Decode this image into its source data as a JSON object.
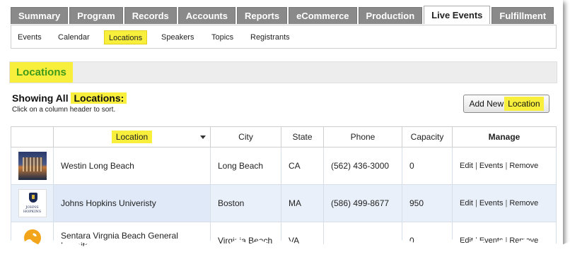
{
  "tabs": [
    {
      "label": "Summary",
      "active": false
    },
    {
      "label": "Program",
      "active": false
    },
    {
      "label": "Records",
      "active": false
    },
    {
      "label": "Accounts",
      "active": false
    },
    {
      "label": "Reports",
      "active": false
    },
    {
      "label": "eCommerce",
      "active": false
    },
    {
      "label": "Production",
      "active": false
    },
    {
      "label": "Live Events",
      "active": true
    },
    {
      "label": "Fulfillment",
      "active": false
    }
  ],
  "subnav": {
    "items": [
      {
        "label": "Events",
        "active": false
      },
      {
        "label": "Calendar",
        "active": false
      },
      {
        "label": "Locations",
        "active": true
      },
      {
        "label": "Speakers",
        "active": false
      },
      {
        "label": "Topics",
        "active": false
      },
      {
        "label": "Registrants",
        "active": false
      }
    ]
  },
  "page": {
    "title": "Locations",
    "showing_prefix": "Showing All",
    "showing_highlight": "Locations:",
    "sort_hint": "Click on a column header to sort.",
    "add_button_prefix": "Add New",
    "add_button_highlight": "Location"
  },
  "table": {
    "headers": {
      "location": "Location",
      "city": "City",
      "state": "State",
      "phone": "Phone",
      "capacity": "Capacity",
      "manage": "Manage"
    },
    "actions": {
      "edit": "Edit",
      "events": "Events",
      "remove": "Remove",
      "separator": "|"
    },
    "rows": [
      {
        "thumb": "hotel-photo",
        "name": "Westin Long Beach",
        "city": "Long Beach",
        "state": "CA",
        "phone": "(562) 436-3000",
        "capacity": "0"
      },
      {
        "thumb": "johns-hopkins-logo",
        "thumb_text": "JOHNS HOPKINS",
        "name": "Johns Hopkins Univeristy",
        "city": "Boston",
        "state": "MA",
        "phone": "(586) 499-8677",
        "capacity": "950"
      },
      {
        "thumb": "sentara-logo",
        "name": "Sentara Virgnia Beach General Hospital",
        "city": "Virginia Beach",
        "state": "VA",
        "phone": "",
        "capacity": "0"
      }
    ]
  },
  "colors": {
    "highlight": "#f7ef3b",
    "title_green": "#3f9a1a",
    "tab_gray": "#8a8a8a",
    "row_alt": "#e9f0f9"
  }
}
